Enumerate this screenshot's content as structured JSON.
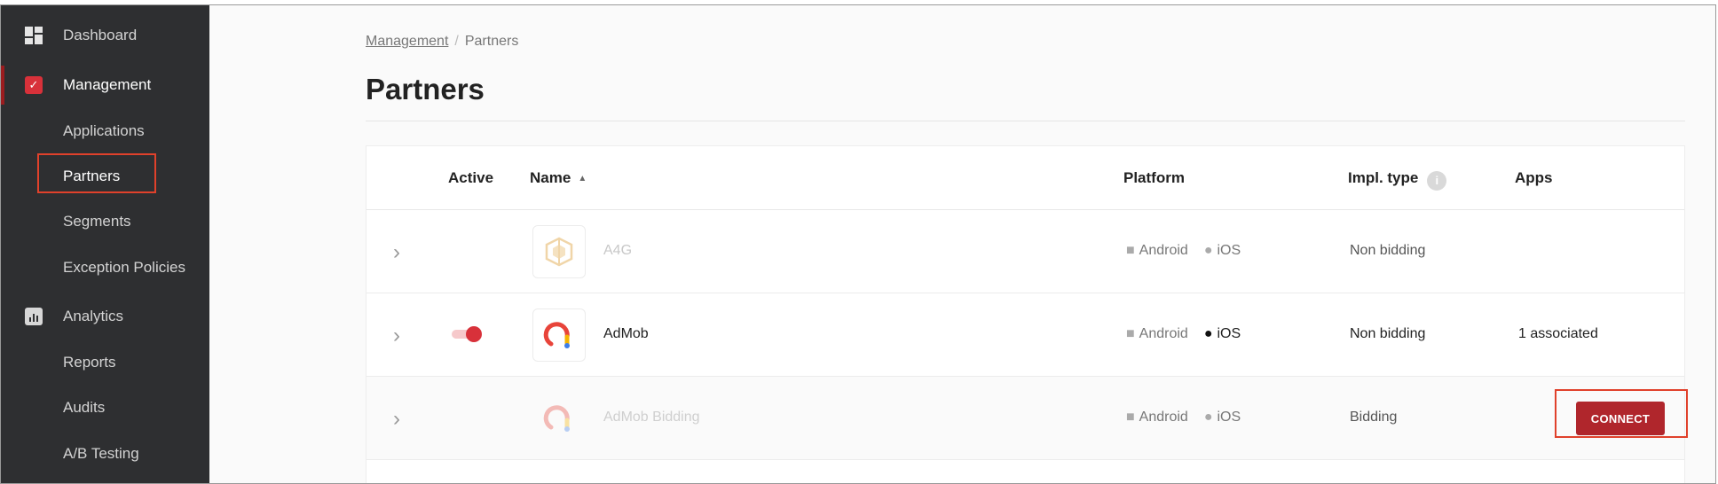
{
  "sidebar": {
    "items": [
      {
        "label": "Dashboard",
        "icon": "dashboard-icon"
      },
      {
        "label": "Management",
        "icon": "management-icon",
        "active": true
      },
      {
        "label": "Applications"
      },
      {
        "label": "Partners",
        "highlighted": true
      },
      {
        "label": "Segments"
      },
      {
        "label": "Exception Policies"
      },
      {
        "label": "Analytics",
        "icon": "analytics-icon"
      },
      {
        "label": "Reports"
      },
      {
        "label": "Audits"
      },
      {
        "label": "A/B Testing"
      }
    ]
  },
  "breadcrumb": {
    "parent": "Management",
    "current": "Partners"
  },
  "page": {
    "title": "Partners"
  },
  "table": {
    "headers": {
      "active": "Active",
      "name": "Name",
      "platform": "Platform",
      "impl_type": "Impl. type",
      "apps": "Apps"
    },
    "rows": [
      {
        "name": "A4G",
        "android": "Android",
        "ios": "iOS",
        "impl": "Non bidding",
        "apps": "",
        "active": false,
        "enabled": false
      },
      {
        "name": "AdMob",
        "android": "Android",
        "ios": "iOS",
        "impl": "Non bidding",
        "apps": "1 associated",
        "active": true,
        "enabled": true
      },
      {
        "name": "AdMob Bidding",
        "android": "Android",
        "ios": "iOS",
        "impl": "Bidding",
        "apps": "",
        "active": false,
        "enabled": false,
        "action": "CONNECT"
      }
    ]
  },
  "colors": {
    "accent": "#b0262c",
    "sidebar_bg": "#2e2f31",
    "highlight": "#e0412b"
  }
}
